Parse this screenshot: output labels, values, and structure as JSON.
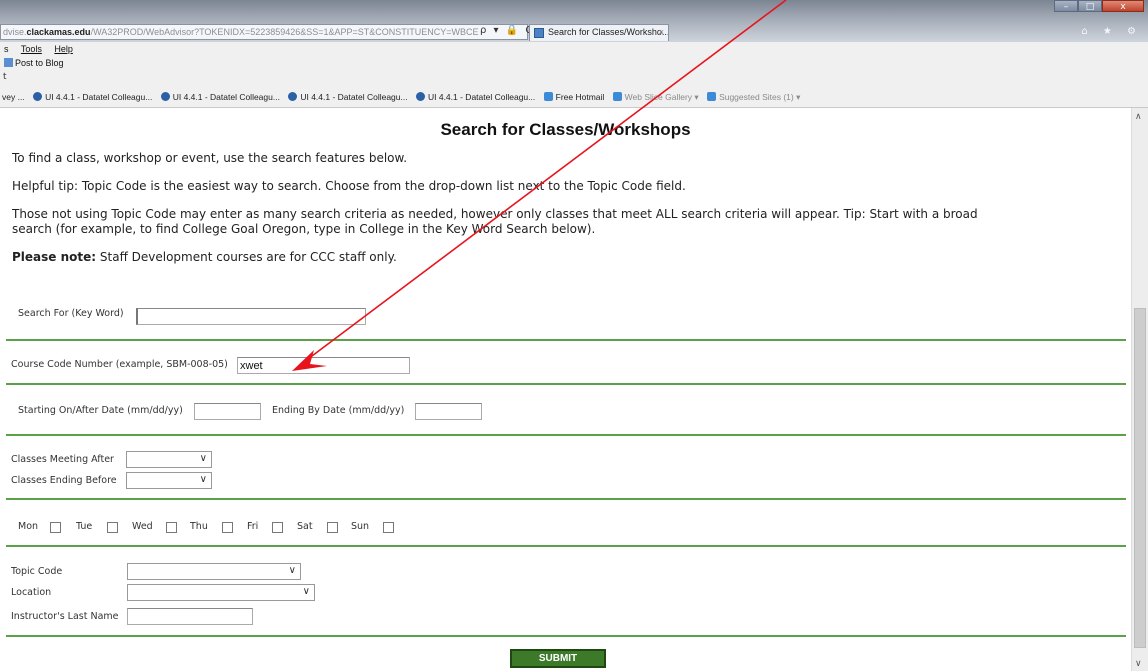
{
  "browser": {
    "address_host": "clackamas.edu",
    "address_prefix": "dvise.",
    "address_path": "/WA32PROD/WebAdvisor?TOKENIDX=5223859426&SS=1&APP=ST&CONSTITUENCY=WBCE",
    "address_icons": "ρ ▾ 🔒 C",
    "tab_title": "Search for Classes/Worksho...",
    "tab_close": "×",
    "window_controls": {
      "min": "–",
      "max": "□",
      "close": "x"
    },
    "right_icons": "⌂ ★ ⚙"
  },
  "menubar": {
    "items": [
      "s",
      "Tools",
      "Help"
    ]
  },
  "commandbar": {
    "post_to_blog": "Post to Blog"
  },
  "blankbar": {
    "text": "t"
  },
  "favorites": {
    "items": [
      {
        "label": "vey ...",
        "icon": "none"
      },
      {
        "label": "UI 4.4.1 - Datatel Colleagu...",
        "icon": "dot"
      },
      {
        "label": "UI 4.4.1 - Datatel Colleagu...",
        "icon": "dot"
      },
      {
        "label": "UI 4.4.1 - Datatel Colleagu...",
        "icon": "dot"
      },
      {
        "label": "UI 4.4.1 - Datatel Colleagu...",
        "icon": "dot"
      },
      {
        "label": "Free Hotmail",
        "icon": "e"
      },
      {
        "label": "Web Slice Gallery ▾",
        "icon": "e",
        "dim": true
      },
      {
        "label": "Suggested Sites (1) ▾",
        "icon": "e",
        "dim": true
      }
    ]
  },
  "page": {
    "title": "Search for Classes/Workshops",
    "intro": "To find a class, workshop or event, use the search features below.",
    "tip": "Helpful tip: Topic Code is the easiest way to search. Choose from the drop-down list next to the Topic Code field.",
    "criteria_line1": "Those not using Topic Code may enter as many search criteria as needed, however only classes that meet ALL search criteria will appear. Tip: Start with a broad",
    "criteria_line2": "search (for example, to find College Goal Oregon, type in College in the Key Word Search below).",
    "note_bold": "Please note:",
    "note_text": " Staff Development courses are for CCC staff only."
  },
  "form": {
    "keyword_label": "Search For (Key Word)",
    "keyword_value": "",
    "course_code_label": "Course Code Number (example, SBM-008-05)",
    "course_code_value": "xwet",
    "start_date_label": "Starting On/After Date (mm/dd/yy)",
    "start_date_value": "",
    "end_date_label": "Ending By Date (mm/dd/yy)",
    "end_date_value": "",
    "meeting_after_label": "Classes Meeting After",
    "ending_before_label": "Classes Ending Before",
    "days": [
      "Mon",
      "Tue",
      "Wed",
      "Thu",
      "Fri",
      "Sat",
      "Sun"
    ],
    "topic_code_label": "Topic Code",
    "location_label": "Location",
    "instructor_label": "Instructor's Last Name",
    "instructor_value": "",
    "submit_label": "SUBMIT",
    "chevron": "∨"
  },
  "colors": {
    "rule": "#5aa14a",
    "submit": "#3c7a2a",
    "annotation": "#e8141c"
  }
}
